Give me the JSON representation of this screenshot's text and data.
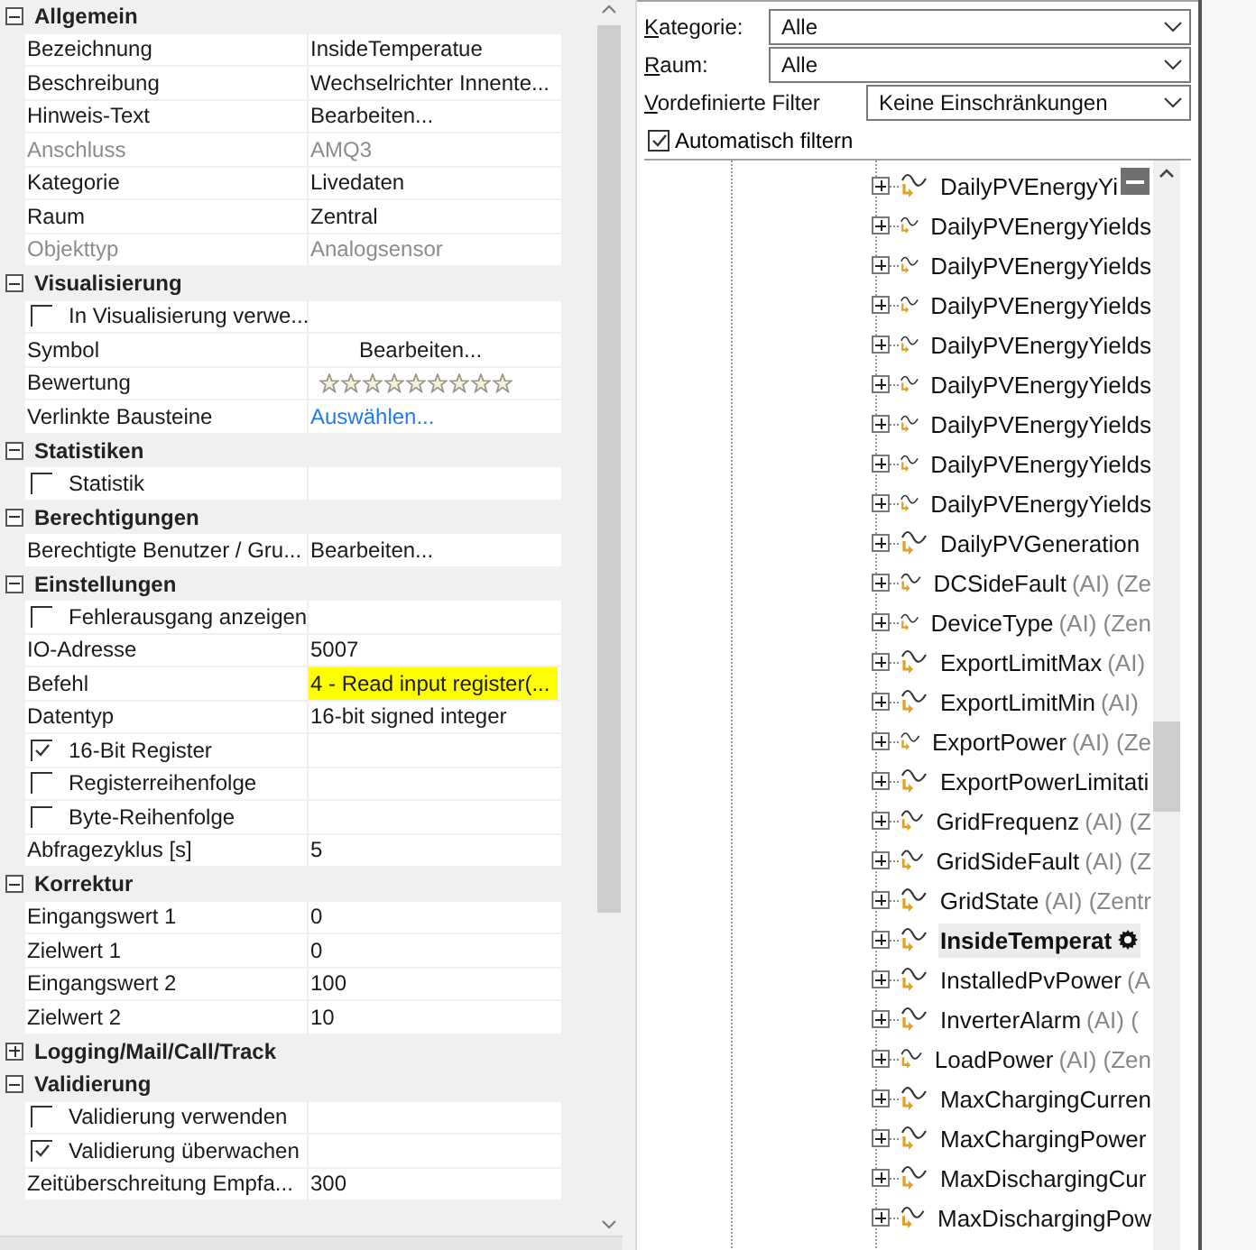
{
  "property_grid": {
    "sections": [
      {
        "title": "Allgemein",
        "expanded": true,
        "rows": [
          {
            "kind": "text",
            "label": "Bezeichnung",
            "value": "InsideTemperatue",
            "disabled": false
          },
          {
            "kind": "text",
            "label": "Beschreibung",
            "value": "Wechselrichter Innente...",
            "disabled": false
          },
          {
            "kind": "text",
            "label": "Hinweis-Text",
            "value": "Bearbeiten...",
            "disabled": false
          },
          {
            "kind": "text",
            "label": "Anschluss",
            "value": "AMQ3",
            "disabled": true
          },
          {
            "kind": "text",
            "label": "Kategorie",
            "value": "Livedaten",
            "disabled": false
          },
          {
            "kind": "text",
            "label": "Raum",
            "value": "Zentral",
            "disabled": false
          },
          {
            "kind": "text",
            "label": "Objekttyp",
            "value": "Analogsensor",
            "disabled": true
          }
        ]
      },
      {
        "title": "Visualisierung",
        "expanded": true,
        "rows": [
          {
            "kind": "checkbox",
            "label": "In Visualisierung verwe...",
            "checked": false,
            "disabled": false
          },
          {
            "kind": "button",
            "label": "Symbol",
            "value": "Bearbeiten...",
            "disabled": false
          },
          {
            "kind": "rating",
            "label": "Bewertung",
            "stars": 0,
            "disabled": false
          },
          {
            "kind": "link",
            "label": "Verlinkte Bausteine",
            "value": "Auswählen...",
            "disabled": false
          }
        ]
      },
      {
        "title": "Statistiken",
        "expanded": true,
        "rows": [
          {
            "kind": "checkbox",
            "label": "Statistik",
            "checked": false,
            "disabled": false
          }
        ]
      },
      {
        "title": "Berechtigungen",
        "expanded": true,
        "rows": [
          {
            "kind": "text",
            "label": "Berechtigte Benutzer / Gru...",
            "value": "Bearbeiten...",
            "disabled": false
          }
        ]
      },
      {
        "title": "Einstellungen",
        "expanded": true,
        "rows": [
          {
            "kind": "checkbox",
            "label": "Fehlerausgang anzeigen",
            "checked": false,
            "disabled": false
          },
          {
            "kind": "text",
            "label": "IO-Adresse",
            "value": "5007",
            "disabled": false
          },
          {
            "kind": "highlighted",
            "label": "Befehl",
            "value": "4 - Read input register(...",
            "disabled": false
          },
          {
            "kind": "text",
            "label": "Datentyp",
            "value": "16-bit signed integer",
            "disabled": false
          },
          {
            "kind": "checkbox",
            "label": "16-Bit Register",
            "checked": true,
            "disabled": false
          },
          {
            "kind": "checkbox",
            "label": "Registerreihenfolge",
            "checked": false,
            "disabled": false
          },
          {
            "kind": "checkbox",
            "label": "Byte-Reihenfolge",
            "checked": false,
            "disabled": false
          },
          {
            "kind": "text",
            "label": "Abfragezyklus [s]",
            "value": "5",
            "disabled": false
          }
        ]
      },
      {
        "title": "Korrektur",
        "expanded": true,
        "rows": [
          {
            "kind": "text",
            "label": "Eingangswert 1",
            "value": "0",
            "disabled": false
          },
          {
            "kind": "text",
            "label": "Zielwert 1",
            "value": "0",
            "disabled": false
          },
          {
            "kind": "text",
            "label": "Eingangswert 2",
            "value": "100",
            "disabled": false
          },
          {
            "kind": "text",
            "label": "Zielwert 2",
            "value": "10",
            "disabled": false
          }
        ]
      },
      {
        "title": "Logging/Mail/Call/Track",
        "expanded": false
      },
      {
        "title": "Validierung",
        "expanded": true,
        "rows": [
          {
            "kind": "checkbox",
            "label": "Validierung verwenden",
            "checked": false,
            "disabled": false
          },
          {
            "kind": "checkbox",
            "label": "Validierung überwachen",
            "checked": true,
            "disabled": false
          },
          {
            "kind": "text",
            "label": "Zeitüberschreitung Empfa...",
            "value": "300",
            "disabled": false
          }
        ]
      }
    ]
  },
  "filters": [
    {
      "label": "Kategorie:",
      "value": "Alle"
    },
    {
      "label": "Raum:",
      "value": "Alle"
    },
    {
      "label": "Vordefinierte Filter",
      "value": "Keine Einschränkungen"
    }
  ],
  "auto_filter": {
    "label": "Automatisch filtern",
    "checked": true
  },
  "tree": {
    "items": [
      {
        "name": "DailyPVEnergyYi",
        "expanded": false,
        "selected": false
      },
      {
        "name": "DailyPVEnergyYields",
        "expanded": false,
        "selected": false
      },
      {
        "name": "DailyPVEnergyYields",
        "expanded": false,
        "selected": false
      },
      {
        "name": "DailyPVEnergyYields",
        "expanded": false,
        "selected": false
      },
      {
        "name": "DailyPVEnergyYields",
        "expanded": false,
        "selected": false
      },
      {
        "name": "DailyPVEnergyYields",
        "expanded": false,
        "selected": false
      },
      {
        "name": "DailyPVEnergyYields",
        "expanded": false,
        "selected": false
      },
      {
        "name": "DailyPVEnergyYields",
        "expanded": false,
        "selected": false
      },
      {
        "name": "DailyPVEnergyYields",
        "expanded": false,
        "selected": false
      },
      {
        "name": "DailyPVGeneration",
        "expanded": false,
        "selected": false
      },
      {
        "name": "DCSideFault",
        "detail": "(AI) (Ze",
        "expanded": false,
        "selected": false
      },
      {
        "name": "DeviceType",
        "detail": "(AI) (Zen",
        "expanded": false,
        "selected": false
      },
      {
        "name": "ExportLimitMax",
        "detail": "(AI)",
        "expanded": false,
        "selected": false
      },
      {
        "name": "ExportLimitMin",
        "detail": "(AI)",
        "expanded": false,
        "selected": false
      },
      {
        "name": "ExportPower",
        "detail": "(AI) (Ze",
        "expanded": false,
        "selected": false
      },
      {
        "name": "ExportPowerLimitati",
        "expanded": false,
        "selected": false
      },
      {
        "name": "GridFrequenz",
        "detail": "(AI) (Z",
        "expanded": false,
        "selected": false
      },
      {
        "name": "GridSideFault",
        "detail": "(AI) (Z",
        "expanded": false,
        "selected": false
      },
      {
        "name": "GridState",
        "detail": "(AI) (Zentr",
        "expanded": false,
        "selected": false
      },
      {
        "name": "InsideTemperat",
        "expanded": false,
        "selected": true
      },
      {
        "name": "InstalledPvPower",
        "detail": "(A",
        "expanded": false,
        "selected": false
      },
      {
        "name": "InverterAlarm",
        "detail": "(AI) (",
        "expanded": false,
        "selected": false
      },
      {
        "name": "LoadPower",
        "detail": "(AI) (Zen",
        "expanded": false,
        "selected": false
      },
      {
        "name": "MaxChargingCurren",
        "expanded": false,
        "selected": false
      },
      {
        "name": "MaxChargingPower",
        "expanded": false,
        "selected": false
      },
      {
        "name": "MaxDischargingCur",
        "expanded": false,
        "selected": false
      },
      {
        "name": "MaxDischargingPow",
        "expanded": false,
        "selected": false
      }
    ]
  }
}
